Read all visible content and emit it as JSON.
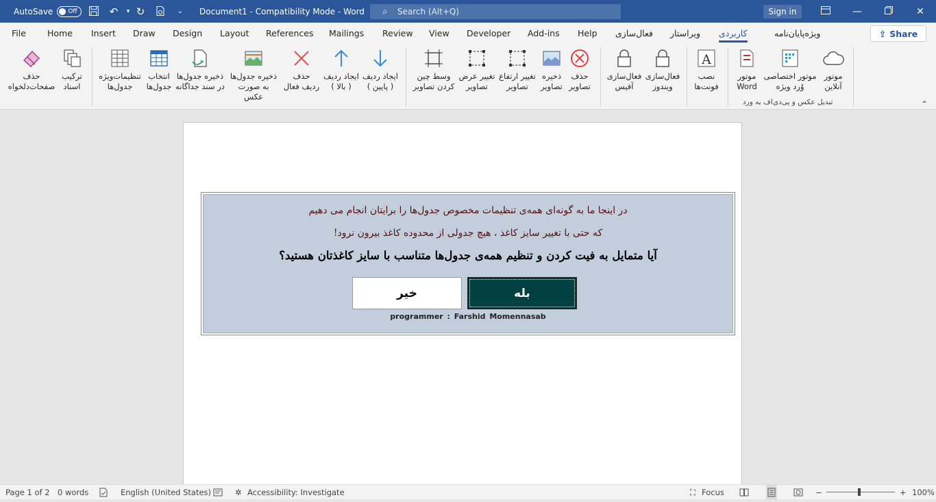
{
  "titlebar": {
    "autosave_label": "AutoSave",
    "autosave_state": "Off",
    "doc_title": "Document1  -  Compatibility Mode  -  Word",
    "search_placeholder": "Search (Alt+Q)",
    "signin_label": "Sign in",
    "qat_icons": [
      "save-icon",
      "undo-icon",
      "redo-icon",
      "print-preview-icon",
      "customize-qat-icon"
    ],
    "window_icons": [
      "ribbon-display-icon",
      "minimize-icon",
      "restore-icon",
      "close-icon"
    ]
  },
  "tabs": [
    "File",
    "Home",
    "Insert",
    "Draw",
    "Design",
    "Layout",
    "References",
    "Mailings",
    "Review",
    "View",
    "Developer",
    "Add-ins",
    "Help",
    "فعال‌سازی",
    "ویراستار",
    "کاربردی",
    "ویژه‌پایان‌نامه"
  ],
  "active_tab": "کاربردی",
  "share_label": "Share",
  "ribbon": {
    "buttons": [
      {
        "l1": "حذف",
        "l2": "صفحات‌دلخواه",
        "icon": "eraser-icon"
      },
      {
        "l1": "ترکیب",
        "l2": "اسناد",
        "icon": "merge-docs-icon"
      },
      {
        "l1": "تنظیمات‌ویژه",
        "l2": "جدول‌ها",
        "icon": "table-settings-icon"
      },
      {
        "l1": "انتخاب",
        "l2": "جدول‌ها",
        "icon": "select-tables-icon"
      },
      {
        "l1": "ذخیره جدول‌ها",
        "l2": "در سند جداگانه",
        "icon": "save-tables-doc-icon"
      },
      {
        "l1": "ذخیره جدول‌ها",
        "l2": "به صورت عکس",
        "icon": "save-tables-image-icon"
      },
      {
        "l1": "حذف",
        "l2": "ردیف فعال",
        "icon": "delete-row-icon"
      },
      {
        "l1": "ایجاد ردیف",
        "l2": "( بالا )",
        "icon": "insert-row-above-icon"
      },
      {
        "l1": "ایجاد ردیف",
        "l2": "( پایین )",
        "icon": "insert-row-below-icon"
      },
      {
        "l1": "وسط چین",
        "l2": "کردن تصاویر",
        "icon": "center-images-icon"
      },
      {
        "l1": "تغییر عرض",
        "l2": "تصاویر",
        "icon": "resize-width-icon"
      },
      {
        "l1": "تغییر ارتفاع",
        "l2": "تصاویر",
        "icon": "resize-height-icon"
      },
      {
        "l1": "ذخیره",
        "l2": "تصاویر",
        "icon": "save-images-icon"
      },
      {
        "l1": "حذف",
        "l2": "تصاویر",
        "icon": "delete-images-icon"
      },
      {
        "l1": "فعال‌سازی",
        "l2": "آفیس",
        "icon": "lock-office-icon"
      },
      {
        "l1": "فعال‌سازی",
        "l2": "ویندوز",
        "icon": "lock-windows-icon"
      },
      {
        "l1": "نصب",
        "l2": "فونت‌ها",
        "icon": "install-fonts-icon"
      },
      {
        "l1": "موتور",
        "l2": "Word",
        "icon": "word-engine-icon"
      },
      {
        "l1": "موتور اختصاصی",
        "l2": "وُرد ویژه",
        "icon": "special-engine-icon"
      },
      {
        "l1": "موتور",
        "l2": "آنلاین",
        "icon": "cloud-engine-icon"
      }
    ],
    "group_label": "تبدیل عکس و پی‌دی‌اف به ورد"
  },
  "dialog": {
    "line1": "در اینجا ما به گونه‌ای همه‌ی تنظیمات مخصوص جدول‌ها را برایتان انجام می دهیم",
    "line2": "که حتی با تغییر سایز کاغذ ، هیچ جدولی از محدوده کاغذ بیرون نرود!",
    "question": "آیا متمایل به فیت کردن و تنظیم همه‌ی جدول‌ها متناسب با سایز کاغذتان هستید؟",
    "no_label": "خیر",
    "yes_label": "بله",
    "programmer": "programmer :  Farshid  Momennasab",
    "yes_color": "#004040",
    "panel_color": "#c2cedb"
  },
  "status": {
    "page": "Page 1 of 2",
    "words": "0 words",
    "language": "English (United States)",
    "accessibility": "Accessibility: Investigate",
    "focus": "Focus",
    "zoom": "100%"
  },
  "colors": {
    "accent": "#2b579a",
    "title_bg": "#2b579a"
  }
}
